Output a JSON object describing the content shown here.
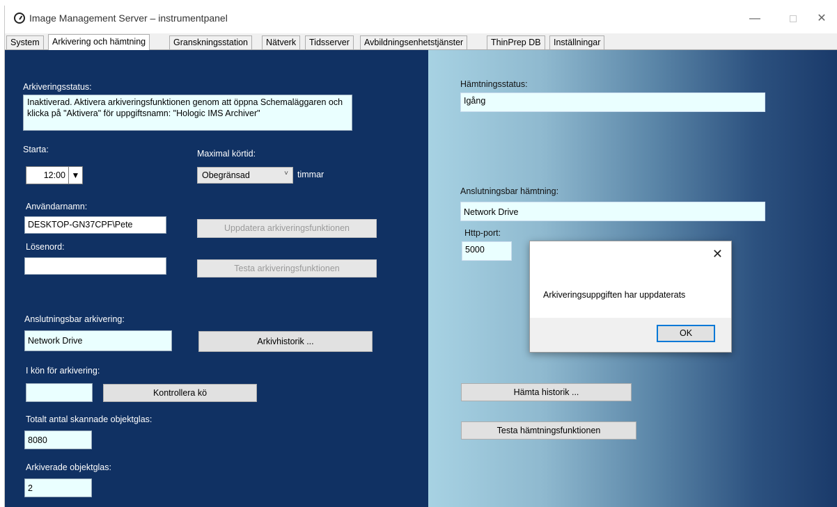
{
  "window": {
    "title": "Image Management Server – instrumentpanel",
    "minimize": "—",
    "close": "✕"
  },
  "tabs": [
    {
      "label": "System"
    },
    {
      "label": "Arkivering och hämtning",
      "active": true
    },
    {
      "label": "Granskningsstation"
    },
    {
      "label": "Nätverk"
    },
    {
      "label": "Tidsserver"
    },
    {
      "label": "Avbildningsenhetstjänster"
    },
    {
      "label": "ThinPrep DB"
    },
    {
      "label": "Inställningar"
    }
  ],
  "archive": {
    "status_label": "Arkiveringsstatus:",
    "status_text": "Inaktiverad. Aktivera arkiveringsfunktionen genom att öppna Schemaläggaren och klicka på \"Aktivera\" för uppgiftsnamn: \"Hologic IMS Archiver\"",
    "start_label": "Starta:",
    "start_time": "12:00",
    "max_runtime_label": "Maximal körtid:",
    "max_runtime_value": "Obegränsad",
    "hours_label": "timmar",
    "username_label": "Användarnamn:",
    "username_value": "DESKTOP-GN37CPF\\Pete",
    "password_label": "Lösenord:",
    "password_value": "",
    "update_button": "Uppdatera arkiveringsfunktionen",
    "test_button": "Testa arkiveringsfunktionen",
    "connectable_label": "Anslutningsbar arkivering:",
    "connectable_value": "Network Drive",
    "history_button": "Arkivhistorik ...",
    "queue_label": "I kön för arkivering:",
    "queue_value": "",
    "check_queue_button": "Kontrollera kö",
    "total_scanned_label": "Totalt antal skannade objektglas:",
    "total_scanned_value": "8080",
    "archived_label": "Arkiverade objektglas:",
    "archived_value": "2"
  },
  "retrieval": {
    "status_label": "Hämtningsstatus:",
    "status_value": "Igång",
    "connectable_label": "Anslutningsbar hämtning:",
    "connectable_value": "Network Drive",
    "http_port_label": "Http-port:",
    "http_port_value": "5000",
    "history_button": "Hämta historik ...",
    "test_button": "Testa hämtningsfunktionen"
  },
  "dialog": {
    "message": "Arkiveringsuppgiften har uppdaterats",
    "ok_button": "OK",
    "close": "✕"
  }
}
